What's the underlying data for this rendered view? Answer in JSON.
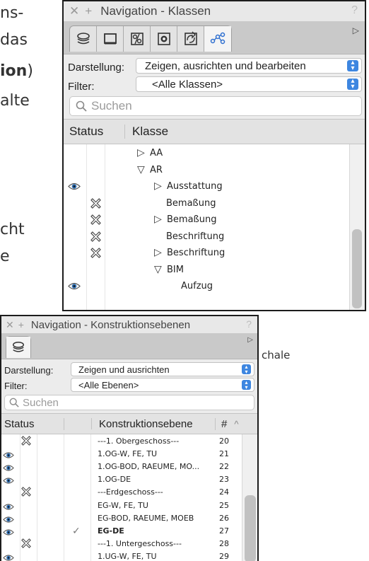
{
  "background_text": {
    "line1": "ns-",
    "line2": "das",
    "line3_bold": "ion",
    "line3_paren": ")",
    "line4": "alte",
    "line5": "cht",
    "line6": "e",
    "beside_lower": "chale"
  },
  "classes_window": {
    "title": "Navigation - Klassen",
    "help_glyph": "?",
    "tabs": [
      "layers-icon",
      "sheet-icon",
      "symbols-icon",
      "viewport-icon",
      "references-icon",
      "classes-icon"
    ],
    "darstellung_label": "Darstellung:",
    "darstellung_value": "Zeigen, ausrichten und bearbeiten",
    "filter_label": "Filter:",
    "filter_value": "<Alle Klassen>",
    "search_placeholder": "Suchen",
    "col_status": "Status",
    "col_klasse": "Klasse",
    "rows": [
      {
        "status": "",
        "marker": "▷",
        "name": "AA",
        "indent": 0
      },
      {
        "status": "",
        "marker": "▽",
        "name": "AR",
        "indent": 0
      },
      {
        "status": "eye",
        "marker": "▷",
        "name": "Ausstattung",
        "indent": 1
      },
      {
        "status": "cross",
        "marker": "",
        "name": "Bemaßung",
        "indent": 2
      },
      {
        "status": "cross",
        "marker": "▷",
        "name": "Bemaßung",
        "indent": 1
      },
      {
        "status": "cross",
        "marker": "",
        "name": "Beschriftung",
        "indent": 2
      },
      {
        "status": "cross",
        "marker": "▷",
        "name": "Beschriftung",
        "indent": 1
      },
      {
        "status": "",
        "marker": "▽",
        "name": "BIM",
        "indent": 1
      },
      {
        "status": "eye",
        "marker": "",
        "name": "Aufzug",
        "indent": 3
      }
    ]
  },
  "levels_window": {
    "title": "Navigation - Konstruktionsebenen",
    "help_glyph": "?",
    "darstellung_label": "Darstellung:",
    "darstellung_value": "Zeigen und ausrichten",
    "filter_label": "Filter:",
    "filter_value": "<Alle Ebenen>",
    "search_placeholder": "Suchen",
    "col_status": "Status",
    "col_ebene": "Konstruktionsebene",
    "col_num": "#",
    "sort_glyph": "^",
    "rows": [
      {
        "status": "cross",
        "active": false,
        "name": "---1. Obergeschoss---",
        "num": "20"
      },
      {
        "status": "eye",
        "active": false,
        "name": "1.OG-W, FE, TU",
        "num": "21"
      },
      {
        "status": "eye",
        "active": false,
        "name": "1.OG-BOD, RAEUME, MO...",
        "num": "22"
      },
      {
        "status": "eye",
        "active": false,
        "name": "1.OG-DE",
        "num": "23"
      },
      {
        "status": "cross",
        "active": false,
        "name": "---Erdgeschoss---",
        "num": "24"
      },
      {
        "status": "eye",
        "active": false,
        "name": "EG-W, FE, TU",
        "num": "25"
      },
      {
        "status": "eye",
        "active": false,
        "name": "EG-BOD, RAEUME, MOEB",
        "num": "26"
      },
      {
        "status": "eye",
        "active": true,
        "name": "EG-DE",
        "num": "27"
      },
      {
        "status": "cross",
        "active": false,
        "name": "---1. Untergeschoss---",
        "num": "28"
      },
      {
        "status": "eye",
        "active": false,
        "name": "1.UG-W, FE, TU",
        "num": "29"
      }
    ]
  }
}
